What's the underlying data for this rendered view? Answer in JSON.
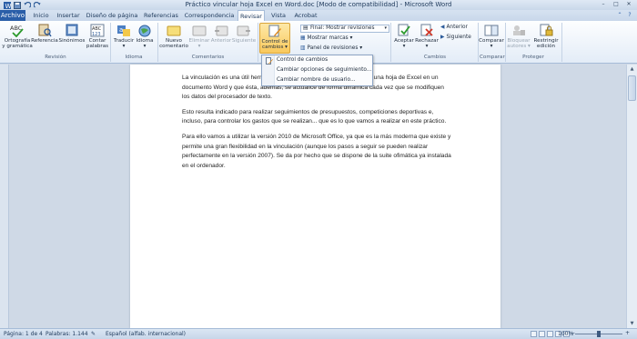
{
  "window": {
    "title": "Práctico vincular hoja Excel en Word.doc [Modo de compatibilidad] - Microsoft Word",
    "controls": [
      "–",
      "□",
      "✕"
    ]
  },
  "tabs": {
    "archivo": "Archivo",
    "items": [
      "Inicio",
      "Insertar",
      "Diseño de página",
      "Referencias",
      "Correspondencia",
      "Revisar",
      "Vista",
      "Acrobat"
    ],
    "active": "Revisar"
  },
  "ribbon": {
    "groups": {
      "revision": "Revisión",
      "idioma": "Idioma",
      "comentarios": "Comentarios",
      "cambios": "Cambios",
      "comparar": "Comparar",
      "proteger": "Proteger"
    },
    "buttons": {
      "ortografia": [
        "Ortografía",
        "y gramática"
      ],
      "referencia": [
        "Referencia",
        ""
      ],
      "sinonimos": [
        "Sinónimos",
        ""
      ],
      "contar": [
        "Contar",
        "palabras"
      ],
      "traducir": [
        "Traducir",
        "▾"
      ],
      "idioma": [
        "Idioma",
        "▾"
      ],
      "nuevo_comentario": [
        "Nuevo",
        "comentario"
      ],
      "eliminar": [
        "Eliminar",
        "▾"
      ],
      "anterior": [
        "Anterior",
        ""
      ],
      "siguiente": [
        "Siguiente",
        ""
      ],
      "control_cambios": [
        "Control de",
        "cambios ▾"
      ],
      "aceptar": [
        "Aceptar",
        "▾"
      ],
      "rechazar": [
        "Rechazar",
        "▾"
      ],
      "comparar": [
        "Comparar",
        "▾"
      ],
      "bloquear": [
        "Bloquear",
        "autores ▾"
      ],
      "restringir": [
        "Restringir",
        "edición"
      ]
    },
    "tracking": {
      "display_value": "Final: Mostrar revisiones",
      "mostrar_marcas": "Mostrar marcas ▾",
      "panel_revisiones": "Panel de revisiones ▾"
    },
    "cambios_nav": {
      "anterior": "Anterior",
      "siguiente": "Siguiente"
    }
  },
  "menu": {
    "items": [
      "Control de cambios",
      "Cambiar opciones de seguimiento...",
      "Cambiar nombre de usuario..."
    ]
  },
  "document": {
    "paragraphs": [
      "La vinculación es una útil herramienta que permite obtener los datos de una hoja de Excel en un documento Word y que ésta, además, se actualice de forma dinámica cada vez que se modifiquen los datos del procesador de texto.",
      "Esto resulta indicado para realizar seguimientos de presupuestos, competiciones deportivas e, incluso, para controlar los gastos que se realizan... que es lo que vamos a realizar en este práctico.",
      "Para ello vamos a utilizar la versión 2010 de Microsoft Office, ya que es la más moderna que existe y permite una gran flexibilidad en la vinculación (aunque los pasos a seguir se pueden realizar perfectamente en la versión 2007). Se da por hecho que se dispone de la suite ofimática ya instalada en el ordenador."
    ]
  },
  "status": {
    "page": "Página: 1 de 4",
    "words": "Palabras: 1.144",
    "language": "Español (alfab. internacional)",
    "zoom": "100%",
    "zoom_minus": "−",
    "zoom_plus": "+"
  }
}
